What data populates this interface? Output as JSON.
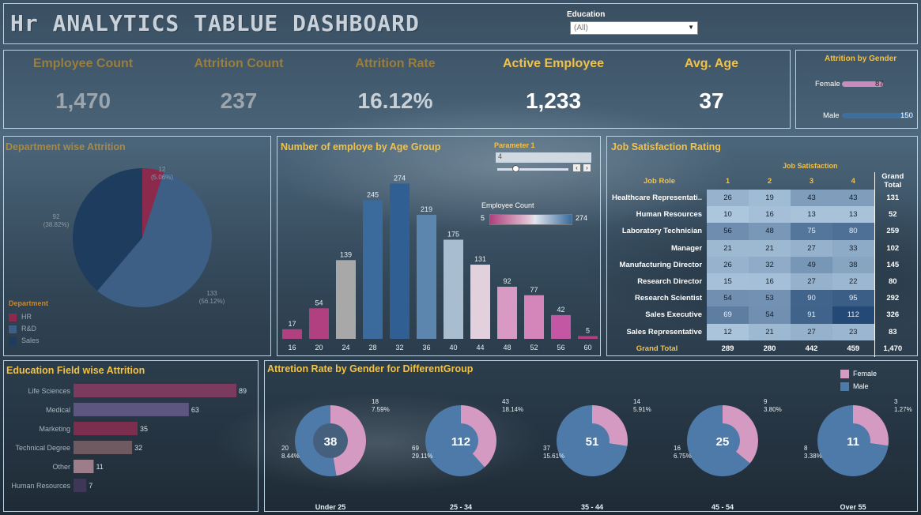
{
  "header": {
    "title": "Hr ANALYTICS TABLUE DASHBOARD",
    "filter_label": "Education",
    "filter_value": "(All)"
  },
  "kpis": [
    {
      "label": "Employee Count",
      "value": "1,470",
      "color": "#9aa5ad"
    },
    {
      "label": "Attrition Count",
      "value": "237",
      "color": "#9aa5ad"
    },
    {
      "label": "Attrition Rate",
      "value": "16.12%",
      "color": "#c7d0d6"
    },
    {
      "label": "Active Employee",
      "value": "1,233",
      "color": "#ffffff"
    },
    {
      "label": "Avg. Age",
      "value": "37",
      "color": "#ffffff"
    }
  ],
  "attrition_by_gender": {
    "title": "Attrition by Gender",
    "rows": [
      {
        "label": "Female",
        "value": 87,
        "value_text": "87",
        "color": "#c98bb9"
      },
      {
        "label": "Male",
        "value": 150,
        "value_text": "150",
        "color": "#3f6f9c"
      }
    ]
  },
  "department": {
    "title": "Department wise Attrition",
    "legend_title": "Department",
    "legend": [
      {
        "label": "HR",
        "color": "#8c2a4e"
      },
      {
        "label": "R&D",
        "color": "#3d5f86"
      },
      {
        "label": "Sales",
        "color": "#1e3c5e"
      }
    ]
  },
  "age_group": {
    "title": "Number of employe by Age Group",
    "parameter_label": "Parameter 1",
    "parameter_value": "4",
    "legend_title": "Employee Count",
    "legend_min": "5",
    "legend_max": "274"
  },
  "job_satisfaction": {
    "title": "Job Satisfaction Rating",
    "subheader": "Job Satisfaction",
    "col_role": "Job Role",
    "columns": [
      "1",
      "2",
      "3",
      "4"
    ],
    "col_total": "Grand Total",
    "rows": [
      {
        "role": "Healthcare Representati..",
        "values": [
          26,
          19,
          43,
          43
        ],
        "total": "131"
      },
      {
        "role": "Human Resources",
        "values": [
          10,
          16,
          13,
          13
        ],
        "total": "52"
      },
      {
        "role": "Laboratory Technician",
        "values": [
          56,
          48,
          75,
          80
        ],
        "total": "259"
      },
      {
        "role": "Manager",
        "values": [
          21,
          21,
          27,
          33
        ],
        "total": "102"
      },
      {
        "role": "Manufacturing Director",
        "values": [
          26,
          32,
          49,
          38
        ],
        "total": "145"
      },
      {
        "role": "Research Director",
        "values": [
          15,
          16,
          27,
          22
        ],
        "total": "80"
      },
      {
        "role": "Research Scientist",
        "values": [
          54,
          53,
          90,
          95
        ],
        "total": "292"
      },
      {
        "role": "Sales Executive",
        "values": [
          69,
          54,
          91,
          112
        ],
        "total": "326"
      },
      {
        "role": "Sales Representative",
        "values": [
          12,
          21,
          27,
          23
        ],
        "total": "83"
      }
    ],
    "grand_total_label": "Grand Total",
    "grand_totals": [
      "289",
      "280",
      "442",
      "459",
      "1,470"
    ]
  },
  "education_field": {
    "title": "Education Field wise Attrition"
  },
  "gender_group": {
    "title": "Attretion Rate by Gender for DifferentGroup",
    "legend": [
      {
        "label": "Female",
        "color": "#d49ac2"
      },
      {
        "label": "Male",
        "color": "#4d7aa8"
      }
    ]
  },
  "chart_data": [
    {
      "type": "pie",
      "title": "Department wise Attrition",
      "categories": [
        "HR",
        "R&D",
        "Sales"
      ],
      "values": [
        12,
        133,
        92
      ],
      "labels": [
        "12\n(5.06%)",
        "133\n(56.12%)",
        "92\n(38.82%)"
      ],
      "colors": [
        "#8c2a4e",
        "#3d5f86",
        "#1e3c5e"
      ]
    },
    {
      "type": "bar",
      "title": "Number of employe by Age Group",
      "categories": [
        "16",
        "20",
        "24",
        "28",
        "32",
        "36",
        "40",
        "44",
        "48",
        "52",
        "56",
        "60"
      ],
      "values": [
        17,
        54,
        139,
        245,
        274,
        219,
        175,
        131,
        92,
        77,
        42,
        5
      ],
      "colors": [
        "#b0407f",
        "#b0407f",
        "#a8a8a8",
        "#3b6a9c",
        "#2f5f93",
        "#5d86ae",
        "#a9bdd0",
        "#e2d1dc",
        "#d899c2",
        "#d486bb",
        "#c357a3",
        "#b0407f"
      ],
      "ylim": [
        0,
        290
      ]
    },
    {
      "type": "bar",
      "title": "Education Field wise Attrition",
      "orientation": "horizontal",
      "categories": [
        "Life Sciences",
        "Medical",
        "Marketing",
        "Technical Degree",
        "Other",
        "Human Resources"
      ],
      "values": [
        89,
        63,
        35,
        32,
        11,
        7
      ],
      "colors": [
        "#7b3b5e",
        "#5d5680",
        "#7b2e4e",
        "#6f5a62",
        "#9e7d8a",
        "#3e3758"
      ]
    },
    {
      "type": "pie",
      "title": "Attretion Rate by Gender for DifferentGroup",
      "groups": [
        {
          "name": "Under 25",
          "total": "38",
          "female": 18,
          "female_label": "18\n7.59%",
          "male": 20,
          "male_label": "20\n8.44%"
        },
        {
          "name": "25 - 34",
          "total": "112",
          "female": 43,
          "female_label": "43\n18.14%",
          "male": 69,
          "male_label": "69\n29.11%"
        },
        {
          "name": "35 - 44",
          "total": "51",
          "female": 14,
          "female_label": "14\n5.91%",
          "male": 37,
          "male_label": "37\n15.61%"
        },
        {
          "name": "45 - 54",
          "total": "25",
          "female": 9,
          "female_label": "9\n3.80%",
          "male": 16,
          "male_label": "16\n6.75%"
        },
        {
          "name": "Over 55",
          "total": "11",
          "female": 3,
          "female_label": "3\n1.27%",
          "male": 8,
          "male_label": "8\n3.38%"
        }
      ]
    }
  ]
}
